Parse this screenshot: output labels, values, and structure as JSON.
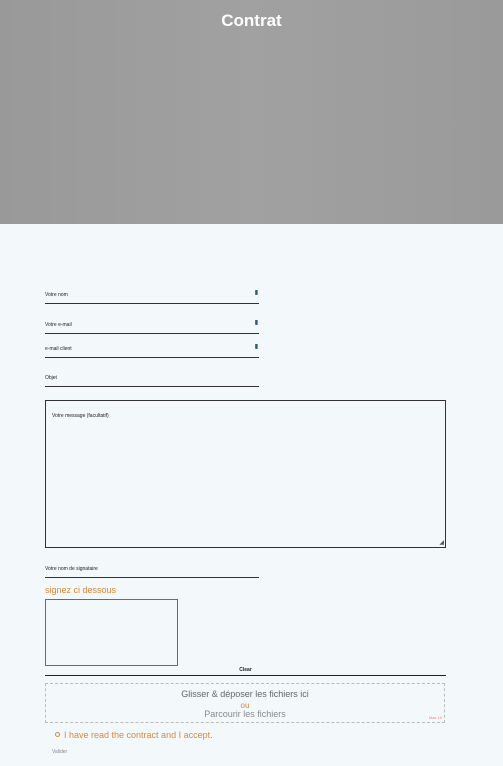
{
  "header": {
    "title": "Contrat"
  },
  "form": {
    "name_label": "Votre nom",
    "email_label": "Votre e-mail",
    "client_email_label": "e-mail client",
    "subject_label": "Objet",
    "message_label": "Votre message (facultatif)",
    "signer_name_label": "Votre nom de signataire",
    "field_icon": "contact-card-icon"
  },
  "signature": {
    "label": "signez ci dessous",
    "clear_label": "Clear"
  },
  "upload": {
    "drag_text": "Glisser & déposer les fichiers ici",
    "or_text": "ou",
    "browse_text": "Parcourir les fichiers",
    "limit_text": "Max 10"
  },
  "accept": {
    "label": "I have read the contract and I accept."
  },
  "submit": {
    "label": "Valider"
  },
  "colors": {
    "accent": "#d7893a",
    "signature_border": "#1a8f86",
    "background": "#f3f8fb"
  }
}
